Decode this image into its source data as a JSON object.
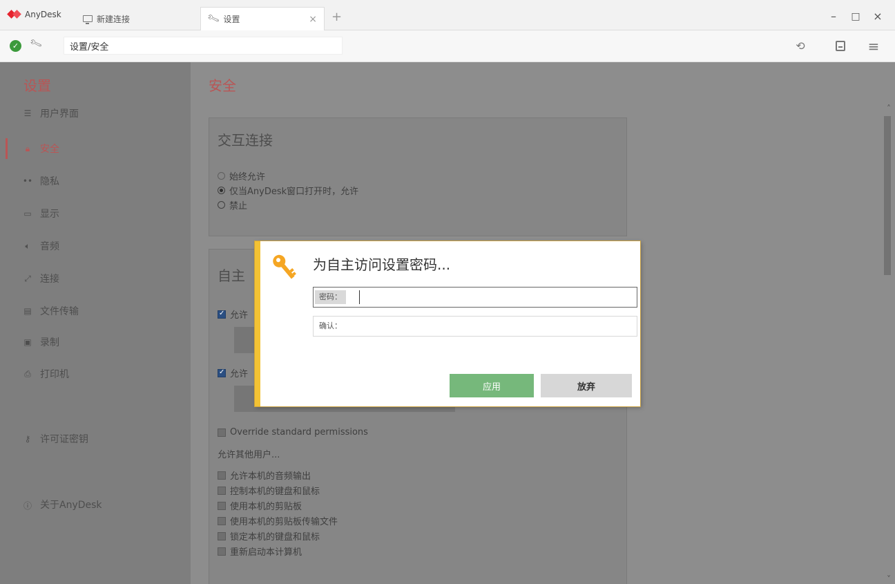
{
  "titlebar": {
    "app_name": "AnyDesk",
    "tabs": [
      {
        "label": "新建连接",
        "icon": "monitor-icon"
      },
      {
        "label": "设置",
        "icon": "wrench-icon",
        "close": "×"
      }
    ],
    "new_tab": "+",
    "window_controls": {
      "minimize": "–",
      "maximize": "□",
      "close": "×"
    }
  },
  "addressbar": {
    "status_icon": "check-icon",
    "path": "设置/安全",
    "toolbar_icons": [
      "history-icon",
      "save-icon",
      "menu-icon"
    ]
  },
  "sidebar": {
    "title": "设置",
    "items": [
      {
        "label": "用户界面",
        "icon": "ui-icon",
        "active": false
      },
      {
        "label": "安全",
        "icon": "lock-icon",
        "active": true
      },
      {
        "label": "隐私",
        "icon": "privacy-icon",
        "active": false
      },
      {
        "label": "显示",
        "icon": "display-icon",
        "active": false
      },
      {
        "label": "音频",
        "icon": "audio-icon",
        "active": false
      },
      {
        "label": "连接",
        "icon": "connection-icon",
        "active": false
      },
      {
        "label": "文件传输",
        "icon": "file-transfer-icon",
        "active": false
      },
      {
        "label": "录制",
        "icon": "record-icon",
        "active": false
      },
      {
        "label": "打印机",
        "icon": "printer-icon",
        "active": false
      },
      {
        "label": "许可证密钥",
        "icon": "key-icon",
        "active": false
      },
      {
        "label": "关于AnyDesk",
        "icon": "info-icon",
        "active": false
      }
    ]
  },
  "main": {
    "title": "安全",
    "interactive_panel": {
      "title": "交互连接",
      "options": [
        {
          "label": "始终允许",
          "selected": false
        },
        {
          "label": "仅当AnyDesk窗口打开时，允许",
          "selected": true
        },
        {
          "label": "禁止",
          "selected": false
        }
      ]
    },
    "unattended_panel": {
      "title_partial": "自主",
      "checkbox1_partial": "允许",
      "checkbox2_partial": "允许",
      "override": "Override standard permissions",
      "others_header": "允许其他用户...",
      "permissions": [
        "允许本机的音频输出",
        "控制本机的键盘和鼠标",
        "使用本机的剪贴板",
        "使用本机的剪贴板传输文件",
        "锁定本机的键盘和鼠标",
        "重新启动本计算机"
      ]
    }
  },
  "dialog": {
    "title": "为自主访问设置密码...",
    "password_label": "密码：",
    "password_value": "",
    "confirm_label": "确认：",
    "confirm_value": "",
    "apply_label": "应用",
    "cancel_label": "放弃"
  },
  "colors": {
    "accent": "#e5232e",
    "dialog_border": "#f3c234",
    "apply_button": "#76b87b"
  }
}
